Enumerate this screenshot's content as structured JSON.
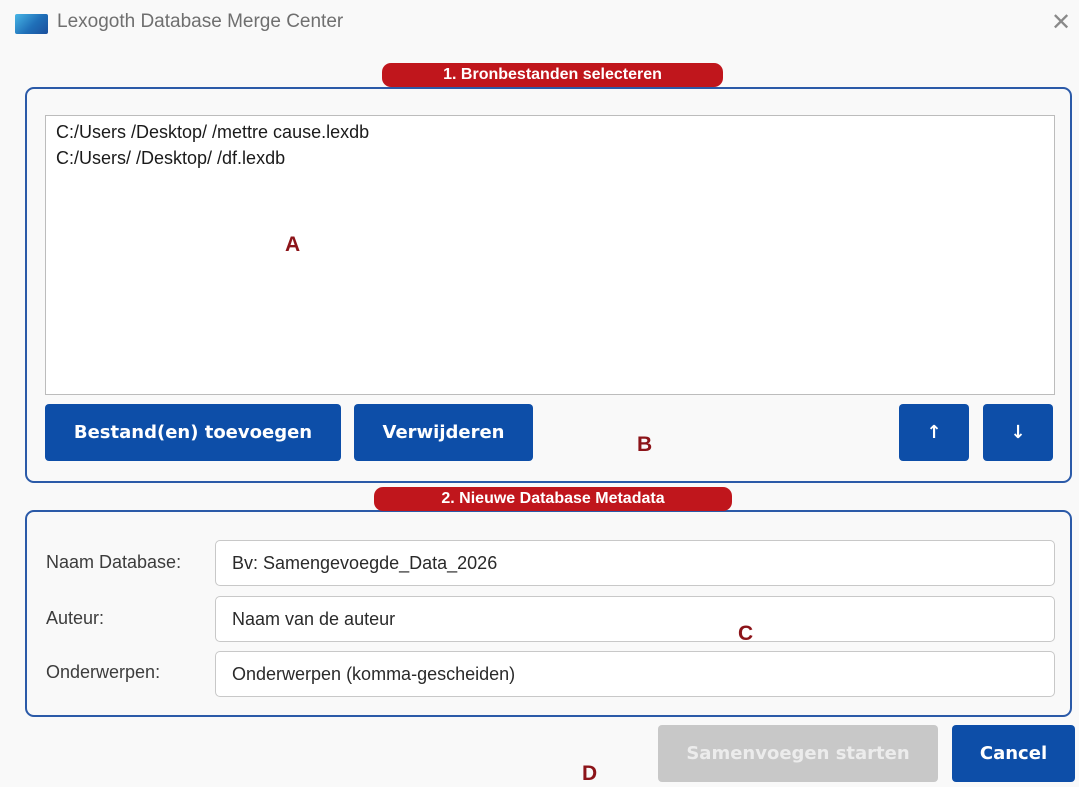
{
  "window": {
    "title": "Lexogoth Database Merge Center",
    "close_icon": "close-icon"
  },
  "section1": {
    "legend": "1. Bronbestanden selecteren",
    "files": [
      "C:/Users          /Desktop/           /mettre cause.lexdb",
      "C:/Users/          /Desktop/           /df.lexdb"
    ],
    "buttons": {
      "add": "Bestand(en) toevoegen",
      "remove": "Verwijderen",
      "up": "↑",
      "down": "↓"
    }
  },
  "section2": {
    "legend": "2. Nieuwe Database Metadata",
    "fields": [
      {
        "label": "Naam Database:",
        "placeholder": "Bv: Samengevoegde_Data_2026"
      },
      {
        "label": "Auteur:",
        "placeholder": "Naam van de auteur"
      },
      {
        "label": "Onderwerpen:",
        "placeholder": "Onderwerpen (komma-gescheiden)"
      }
    ]
  },
  "footer": {
    "start_label": "Samenvoegen starten",
    "cancel_label": "Cancel"
  },
  "annotations": {
    "a": "A",
    "b": "B",
    "c": "C",
    "d": "D"
  },
  "colors": {
    "accent": "#0d4ea8",
    "legend_bg": "#c0161c",
    "group_border": "#2b5aa8",
    "annotation": "#8c1419",
    "disabled": "#c8c8c8"
  }
}
